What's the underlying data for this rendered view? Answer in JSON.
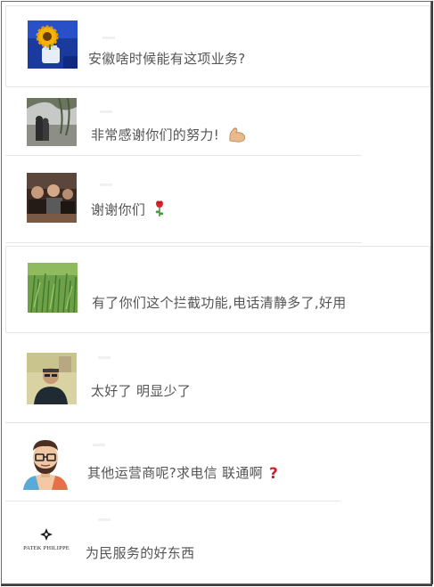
{
  "comments": [
    {
      "text": "安徽啥时候能有这项业务?",
      "avatar": "sunflower-vase-photo"
    },
    {
      "text": "非常感谢你们的努力!",
      "avatar": "couple-by-willow-photo",
      "emoji": "flexed-biceps-icon"
    },
    {
      "text": "谢谢你们",
      "avatar": "people-at-table-photo",
      "emoji": "rose-icon"
    },
    {
      "text": "有了你们这个拦截功能,电话清静多了,好用",
      "avatar": "green-field-photo"
    },
    {
      "text": "太好了 明显少了",
      "avatar": "man-in-glasses-photo"
    },
    {
      "text": "其他运营商呢?求电信 联通啊",
      "avatar": "cartoon-man-with-beard",
      "emoji": "red-question-mark-icon"
    },
    {
      "text": "为民服务的好东西",
      "avatar": "patek-philippe-logo",
      "logo_text": "PATEK PHILIPPE"
    }
  ],
  "colors": {
    "text": "#555555",
    "divider": "#e2e2e2",
    "frame": "#6b6b6b"
  }
}
